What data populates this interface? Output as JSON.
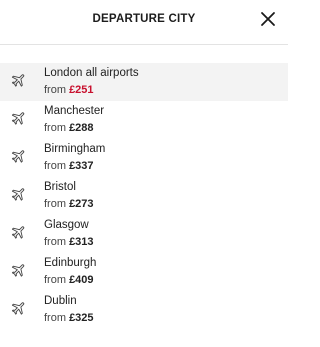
{
  "header": {
    "title": "DEPARTURE CITY",
    "close_icon": "close-icon"
  },
  "colors": {
    "highlight_price": "#c8102e",
    "selected_row_bg": "#f3f3f3"
  },
  "cities": [
    {
      "name": "London all airports",
      "from": "from",
      "price": "£251",
      "selected": true
    },
    {
      "name": "Manchester",
      "from": "from",
      "price": "£288"
    },
    {
      "name": "Birmingham",
      "from": "from",
      "price": "£337"
    },
    {
      "name": "Bristol",
      "from": "from",
      "price": "£273"
    },
    {
      "name": "Glasgow",
      "from": "from",
      "price": "£313"
    },
    {
      "name": "Edinburgh",
      "from": "from",
      "price": "£409"
    },
    {
      "name": "Dublin",
      "from": "from",
      "price": "£325"
    }
  ],
  "icons": {
    "row_icon": "plane-icon"
  }
}
